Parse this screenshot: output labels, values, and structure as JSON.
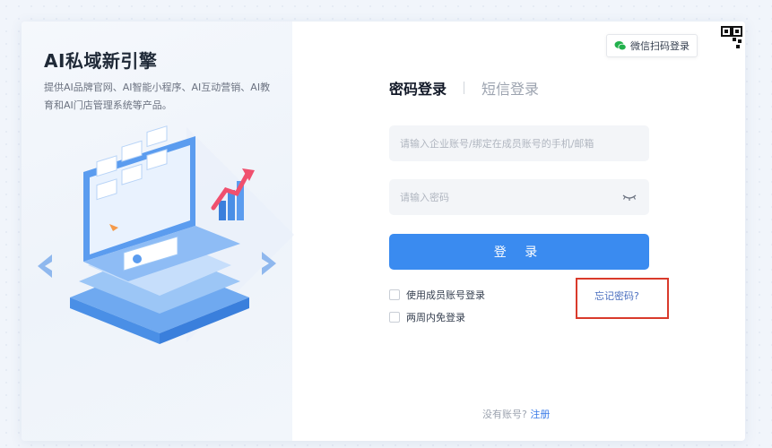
{
  "brand": {
    "title": "AI私域新引擎",
    "description": "提供AI品牌官网、AI智能小程序、AI互动营销、AI教育和AI门店管理系统等产品。"
  },
  "header": {
    "wechat_login_label": "微信扫码登录"
  },
  "tabs": [
    {
      "label": "密码登录",
      "active": true
    },
    {
      "label": "短信登录",
      "active": false
    }
  ],
  "form": {
    "account_placeholder": "请输入企业账号/绑定在成员账号的手机/邮箱",
    "password_placeholder": "请输入密码",
    "submit_label": "登 录",
    "member_login_label": "使用成员账号登录",
    "remember_label": "两周内免登录",
    "forgot_label": "忘记密码?"
  },
  "footer": {
    "no_account_text": "没有账号?",
    "register_label": "注册"
  },
  "colors": {
    "primary": "#3a8bf0",
    "highlight_border": "#d93a2b",
    "wechat_green": "#22b14c"
  }
}
